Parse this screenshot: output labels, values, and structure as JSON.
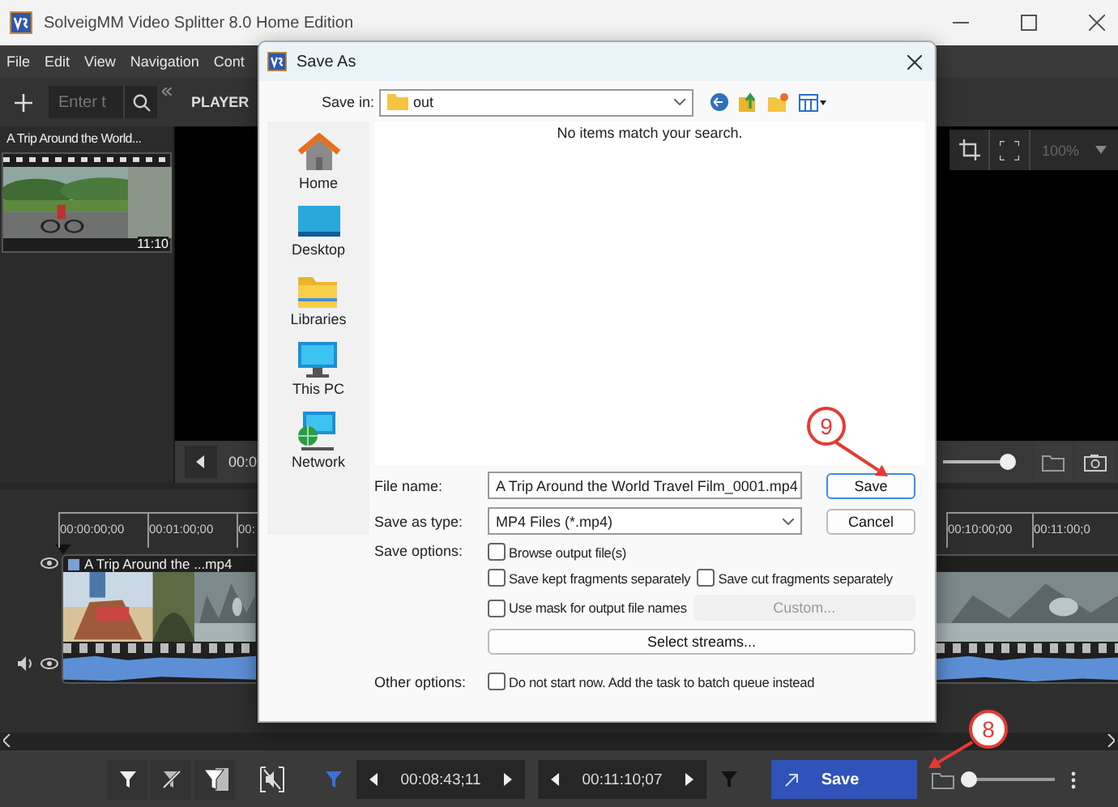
{
  "window": {
    "title": "SolveigMM Video Splitter 8.0 Home Edition"
  },
  "menu": [
    {
      "label": "File"
    },
    {
      "label": "Edit"
    },
    {
      "label": "View"
    },
    {
      "label": "Navigation"
    },
    {
      "label": "Cont"
    }
  ],
  "toolbar": {
    "search": {
      "placeholder": "Enter t"
    },
    "tab": "PLAYER"
  },
  "media_list": [
    {
      "title": "A Trip Around the World...",
      "duration": "11:10"
    }
  ],
  "player": {
    "zoom": "100%",
    "position": "00:0",
    "seek": {
      "level": 0.95
    }
  },
  "timeline": {
    "ruler_start": [
      "00:00:00;00",
      "00:01:00;00",
      "00:"
    ],
    "ruler_end": [
      "00:10:00;00",
      "00:11:00;0"
    ],
    "clip": {
      "label": "A Trip Around the ...mp4"
    }
  },
  "bottom_bar": {
    "start_time": "00:08:43;11",
    "end_time": "00:11:10;07",
    "save": "Save",
    "zoom": {
      "level": 0.05
    }
  },
  "dialog": {
    "title": "Save As",
    "save_in_label": "Save in:",
    "save_in": "out",
    "empty_message": "No items match your search.",
    "places": [
      {
        "kind": "home",
        "label": "Home"
      },
      {
        "kind": "desktop",
        "label": "Desktop"
      },
      {
        "kind": "libraries",
        "label": "Libraries"
      },
      {
        "kind": "pc",
        "label": "This PC"
      },
      {
        "kind": "network",
        "label": "Network"
      }
    ],
    "file_name_label": "File name:",
    "file_name": "A Trip Around the World Travel Film_0001.mp4",
    "type_label": "Save as type:",
    "type": "MP4 Files (*.mp4)",
    "buttons": [
      {
        "label": "Save",
        "default": true
      },
      {
        "label": "Cancel",
        "default": false
      }
    ],
    "save_options_label": "Save options:",
    "save_options": [
      {
        "items": [
          {
            "kind": "checkbox",
            "label": "Browse output file(s)",
            "checked": false
          }
        ]
      },
      {
        "items": [
          {
            "kind": "checkbox",
            "label": "Save kept fragments separately",
            "checked": false
          },
          {
            "kind": "checkbox",
            "label": "Save cut fragments separately",
            "checked": false
          }
        ]
      },
      {
        "items": [
          {
            "kind": "checkbox",
            "label": "Use mask for output file names",
            "checked": false
          },
          {
            "kind": "button",
            "label": "Custom...",
            "disabled": true
          }
        ]
      },
      {
        "items": [
          {
            "kind": "button",
            "label": "Select streams...",
            "disabled": false
          }
        ]
      }
    ],
    "other_options_label": "Other options:",
    "other_options": [
      {
        "kind": "checkbox",
        "label": "Do not start now. Add the task to batch queue instead",
        "checked": false
      }
    ]
  },
  "callouts": [
    {
      "number": "9"
    },
    {
      "number": "8"
    }
  ]
}
